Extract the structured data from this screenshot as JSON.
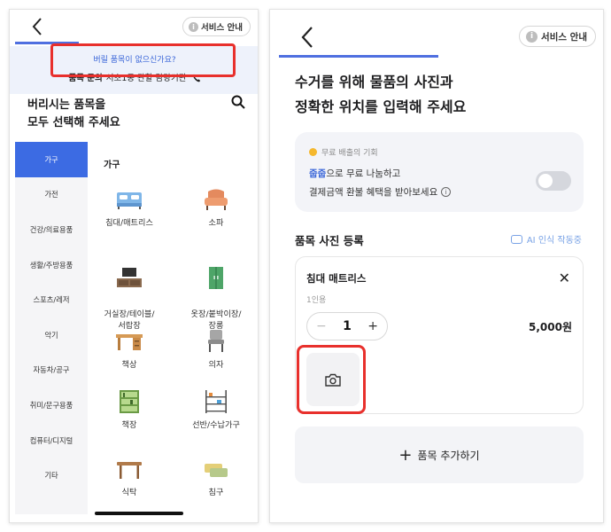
{
  "left": {
    "service_guide": "서비스 안내",
    "info_mark": "i",
    "notice": {
      "question": "버릴 품목이 없으신가요?",
      "label": "품목 문의",
      "contact": "서초1동 관할 담당기관"
    },
    "heading": [
      "버리시는 품목을",
      "모두 선택해 주세요"
    ],
    "categories": [
      "가구",
      "가전",
      "건강/의료용품",
      "생활/주방용품",
      "스포츠/레저",
      "악기",
      "자동차/공구",
      "취미/문구용품",
      "컴퓨터/디지털",
      "기타"
    ],
    "active_category": "가구",
    "section_title": "가구",
    "items": [
      {
        "label": "침대/매트리스",
        "icon": "bed-icon"
      },
      {
        "label": "소파",
        "icon": "sofa-icon"
      },
      {
        "label": "거실장/테이블/\n서랍장",
        "icon": "tv-stand-icon"
      },
      {
        "label": "옷장/붙박이장/\n장롱",
        "icon": "wardrobe-icon"
      },
      {
        "label": "책상",
        "icon": "desk-icon"
      },
      {
        "label": "의자",
        "icon": "chair-icon"
      },
      {
        "label": "책장",
        "icon": "bookcase-icon"
      },
      {
        "label": "선반/수납가구",
        "icon": "shelf-icon"
      },
      {
        "label": "식탁",
        "icon": "dining-table-icon"
      },
      {
        "label": "침구",
        "icon": "bedding-icon"
      }
    ]
  },
  "right": {
    "service_guide": "서비스 안내",
    "info_mark": "i",
    "heading": [
      "수거를 위해 물품의 사진과",
      "정확한 위치를 입력해 주세요"
    ],
    "promo": {
      "badge": "무료 배출의 기회",
      "brand": "줍줍",
      "line1_rest": "으로 무료 나눔하고",
      "line2": "결제금액 환불 혜택을 받아보세요",
      "info_mark": "i",
      "toggle_on": false
    },
    "photo_section_title": "품목 사진 등록",
    "ai_status": "AI 인식 작동중",
    "card": {
      "name": "침대 매트리스",
      "sub": "1인용",
      "minus": "−",
      "quantity": "1",
      "plus": "+",
      "price": "5,000원",
      "close": "✕"
    },
    "add_plus": "+",
    "add_item": "품목 추가하기"
  },
  "colors": {
    "accent": "#3c6be3",
    "highlight": "#e8302c",
    "ai_text": "#7aa3e6"
  }
}
